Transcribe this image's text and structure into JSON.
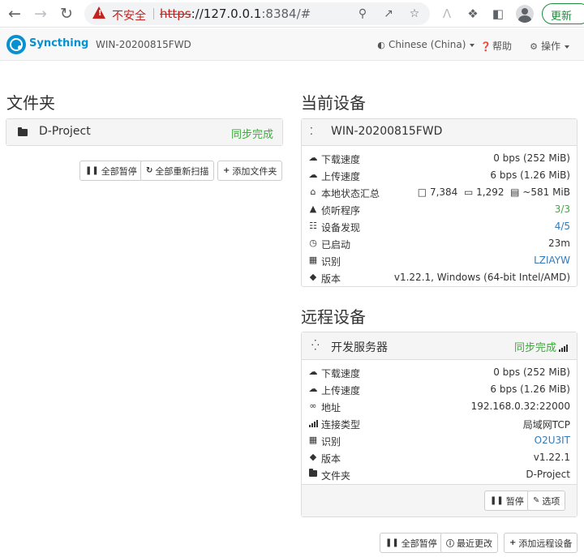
{
  "browser": {
    "security_label": "不安全",
    "url_protocol": "https",
    "url_host": "://127.0.0.1",
    "url_rest": ":8384/#",
    "update_label": "更新"
  },
  "navbar": {
    "brand": "Syncthing",
    "device_name": "WIN-20200815FWD",
    "language": "Chinese (China)",
    "help": "帮助",
    "actions": "操作"
  },
  "folders": {
    "heading": "文件夹",
    "items": [
      {
        "name": "D-Project",
        "status": "同步完成"
      }
    ],
    "buttons": {
      "pause_all": "全部暂停",
      "rescan_all": "全部重新扫描",
      "add_folder": "添加文件夹"
    }
  },
  "this_device": {
    "heading": "当前设备",
    "name": "WIN-20200815FWD",
    "rows": {
      "download": {
        "label": "下载速度",
        "value": "0 bps (252 MiB)"
      },
      "upload": {
        "label": "上传速度",
        "value": "6 bps (1.26 MiB)"
      },
      "local_state": {
        "label": "本地状态汇总",
        "files": "7,384",
        "dirs": "1,292",
        "size": "~581 MiB"
      },
      "listeners": {
        "label": "侦听程序",
        "value": "3/3"
      },
      "discovery": {
        "label": "设备发现",
        "value": "4/5"
      },
      "uptime": {
        "label": "已启动",
        "value": "23m"
      },
      "id": {
        "label": "识别",
        "value": "LZIAYW"
      },
      "version": {
        "label": "版本",
        "value": "v1.22.1, Windows (64-bit Intel/AMD)"
      }
    }
  },
  "remote_devices": {
    "heading": "远程设备",
    "items": [
      {
        "name": "开发服务器",
        "status": "同步完成",
        "rows": {
          "download": {
            "label": "下载速度",
            "value": "0 bps (252 MiB)"
          },
          "upload": {
            "label": "上传速度",
            "value": "6 bps (1.26 MiB)"
          },
          "address": {
            "label": "地址",
            "value": "192.168.0.32:22000"
          },
          "conn_type": {
            "label": "连接类型",
            "value": "局域网TCP"
          },
          "id": {
            "label": "识别",
            "value": "O2U3IT"
          },
          "version": {
            "label": "版本",
            "value": "v1.22.1"
          },
          "folders": {
            "label": "文件夹",
            "value": "D-Project"
          }
        },
        "buttons": {
          "pause": "暂停",
          "options": "选项"
        }
      }
    ],
    "buttons": {
      "pause_all": "全部暂停",
      "recent_changes": "最近更改",
      "add_device": "添加远程设备"
    }
  },
  "colors": {
    "accent": "#0891d1",
    "success": "#3fa93f",
    "link": "#337ab7"
  }
}
